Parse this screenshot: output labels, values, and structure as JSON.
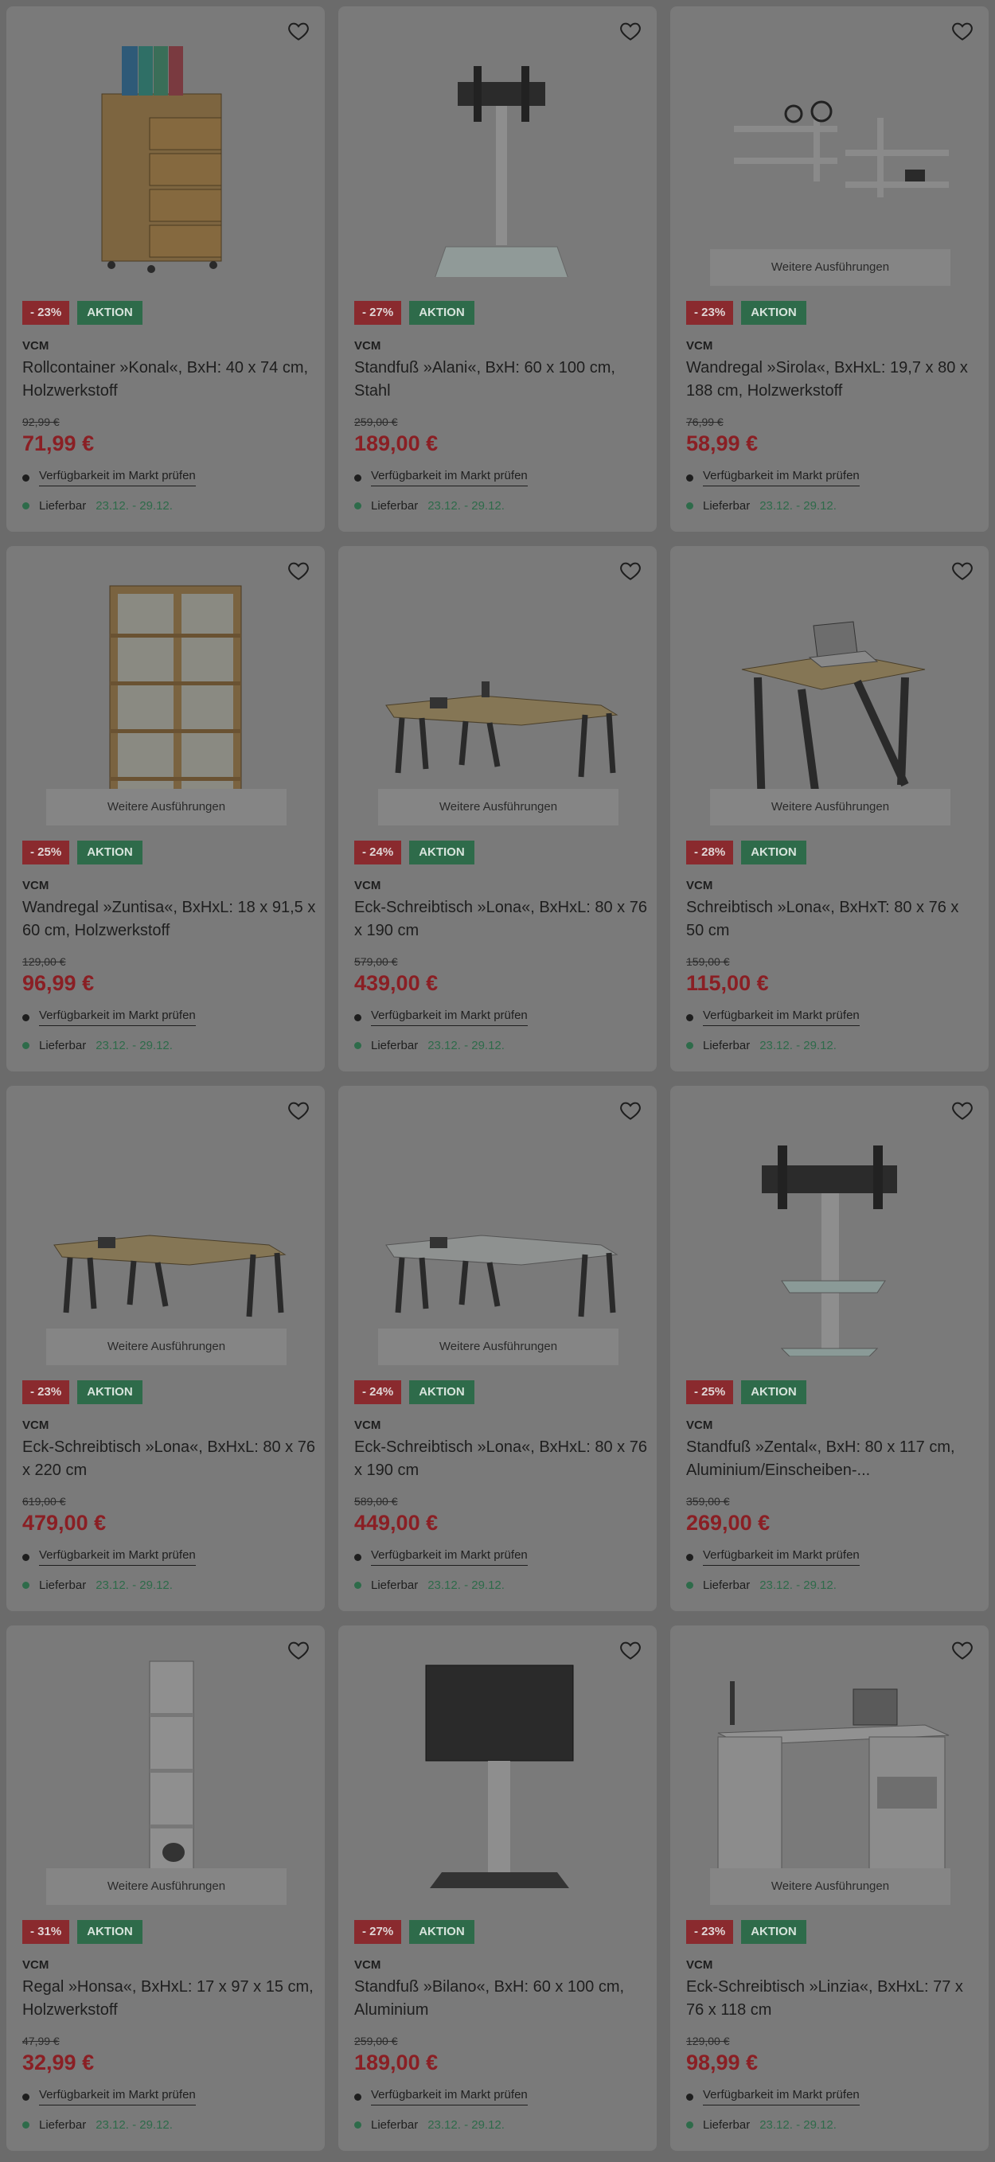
{
  "common": {
    "variants_label": "Weitere Ausführungen",
    "action_label": "AKTION",
    "availability_label": "Verfügbarkeit im Markt prüfen",
    "delivery_label": "Lieferbar",
    "delivery_dates": "23.12. - 29.12."
  },
  "products": [
    {
      "brand": "VCM",
      "title": "Rollcontainer »Konal«, BxH: 40 x 74 cm, Holzwerkstoff",
      "discount": "- 23%",
      "old_price": "92,99 €",
      "price": "71,99 €",
      "image": "drawer-container",
      "variants": false
    },
    {
      "brand": "VCM",
      "title": "Standfuß »Alani«, BxH: 60 x 100 cm, Stahl",
      "discount": "- 27%",
      "old_price": "259,00 €",
      "price": "189,00 €",
      "image": "tv-stand",
      "variants": false
    },
    {
      "brand": "VCM",
      "title": "Wandregal »Sirola«, BxHxL: 19,7 x 80 x 188 cm, Holzwerkstoff",
      "discount": "- 23%",
      "old_price": "76,99 €",
      "price": "58,99 €",
      "image": "wall-shelf",
      "variants": true
    },
    {
      "brand": "VCM",
      "title": "Wandregal »Zuntisa«, BxHxL: 18 x 91,5 x 60 cm, Holzwerkstoff",
      "discount": "- 25%",
      "old_price": "129,00 €",
      "price": "96,99 €",
      "image": "bookshelf",
      "variants": true
    },
    {
      "brand": "VCM",
      "title": "Eck-Schreibtisch »Lona«, BxHxL: 80 x 76 x 190 cm",
      "discount": "- 24%",
      "old_price": "579,00 €",
      "price": "439,00 €",
      "image": "corner-desk",
      "variants": true
    },
    {
      "brand": "VCM",
      "title": "Schreibtisch »Lona«, BxHxT: 80 x 76 x 50 cm",
      "discount": "- 28%",
      "old_price": "159,00 €",
      "price": "115,00 €",
      "image": "desk",
      "variants": true
    },
    {
      "brand": "VCM",
      "title": "Eck-Schreibtisch »Lona«, BxHxL: 80 x 76 x 220 cm",
      "discount": "- 23%",
      "old_price": "619,00 €",
      "price": "479,00 €",
      "image": "corner-desk",
      "variants": true
    },
    {
      "brand": "VCM",
      "title": "Eck-Schreibtisch »Lona«, BxHxL: 80 x 76 x 190 cm",
      "discount": "- 24%",
      "old_price": "589,00 €",
      "price": "449,00 €",
      "image": "corner-desk-light",
      "variants": true
    },
    {
      "brand": "VCM",
      "title": "Standfuß »Zental«, BxH: 80 x 117 cm, Aluminium/Einscheiben-...",
      "discount": "- 25%",
      "old_price": "359,00 €",
      "price": "269,00 €",
      "image": "tv-stand-shelf",
      "variants": false
    },
    {
      "brand": "VCM",
      "title": "Regal »Honsa«, BxHxL: 17 x 97 x 15 cm, Holzwerkstoff",
      "discount": "- 31%",
      "old_price": "47,99 €",
      "price": "32,99 €",
      "image": "narrow-shelf",
      "variants": true
    },
    {
      "brand": "VCM",
      "title": "Standfuß »Bilano«, BxH: 60 x 100 cm, Aluminium",
      "discount": "- 27%",
      "old_price": "259,00 €",
      "price": "189,00 €",
      "image": "tv-stand-screen",
      "variants": false
    },
    {
      "brand": "VCM",
      "title": "Eck-Schreibtisch »Linzia«, BxHxL: 77 x 76 x 118 cm",
      "discount": "- 23%",
      "old_price": "129,00 €",
      "price": "98,99 €",
      "image": "white-corner-desk",
      "variants": true
    }
  ]
}
